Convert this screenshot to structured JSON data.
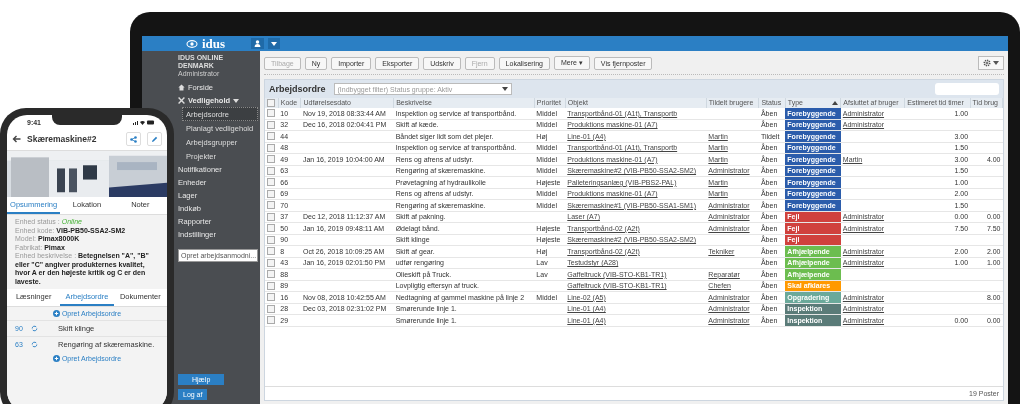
{
  "laptop": {
    "topbar": {
      "logo": "idus"
    },
    "sidebar": {
      "org": "IDUS ONLINE DENMARK",
      "user": "Administrator",
      "items": [
        {
          "label": "Forside",
          "selected": false
        },
        {
          "label": "Vedligehold",
          "selected": true,
          "expanded": true,
          "children": [
            {
              "label": "Arbejdsordre",
              "selected": true
            },
            {
              "label": "Planlagt vedligehold",
              "selected": false
            },
            {
              "label": "Arbejdsgrupper",
              "selected": false
            },
            {
              "label": "Projekter",
              "selected": false
            }
          ]
        },
        {
          "label": "Notifikationer",
          "selected": false
        },
        {
          "label": "Enheder",
          "selected": false
        },
        {
          "label": "Lager",
          "selected": false
        },
        {
          "label": "Indkøb",
          "selected": false
        },
        {
          "label": "Rapporter",
          "selected": false
        },
        {
          "label": "Indstillinger",
          "selected": false
        }
      ],
      "dropdown": "Opret arbejdsanmodni...",
      "help_button": "Hjælp",
      "logout_button": "Log af"
    },
    "toolbar": [
      {
        "label": "Tilbage",
        "disabled": true
      },
      {
        "label": "Ny",
        "disabled": false
      },
      {
        "label": "Importer",
        "disabled": false
      },
      {
        "label": "Eksporter",
        "disabled": false
      },
      {
        "label": "Udskriv",
        "disabled": false
      },
      {
        "label": "Fjern",
        "disabled": true
      },
      {
        "label": "Lokalisering",
        "disabled": false
      },
      {
        "label": "Mere ▾",
        "disabled": false
      },
      {
        "label": "Vis fjernposter",
        "disabled": false
      }
    ],
    "table": {
      "select_all_checked": false,
      "title": "Arbejdsordre",
      "filter": "(Indbygget filter) Status gruppe: Aktiv",
      "columns": [
        {
          "label": "Kode",
          "sorted": false
        },
        {
          "label": "Udførelsesdato",
          "sorted": false
        },
        {
          "label": "Beskrivelse",
          "sorted": false
        },
        {
          "label": "Prioritet",
          "sorted": false
        },
        {
          "label": "Objekt",
          "sorted": false
        },
        {
          "label": "Tildelt brugere",
          "sorted": false
        },
        {
          "label": "Status",
          "sorted": false
        },
        {
          "label": "Type",
          "sorted": true
        },
        {
          "label": "Afsluttet af bruger",
          "sorted": false
        },
        {
          "label": "Estimeret tid timer",
          "sorted": false
        },
        {
          "label": "Tid brug",
          "sorted": false
        }
      ],
      "rows": [
        {
          "checked": false,
          "code": "10",
          "date": "Nov 19, 2018 08:33:44 AM",
          "description": "Inspektion og service af transportbånd.",
          "priority": "Middel",
          "object": "Transportbånd-01 (A1t), Transportb",
          "status": "Åben",
          "type": {
            "label": "Forebyggende",
            "color": "#2b5cab"
          },
          "closed_by": "Administrator",
          "estimate": "1.00"
        },
        {
          "checked": false,
          "code": "32",
          "date": "Dec 16, 2018 02:04:41 PM",
          "description": "Skift af kæde.",
          "priority": "Middel",
          "object": "Produktions maskine-01 (A7)",
          "status": "Åben",
          "type": {
            "label": "Forebyggende",
            "color": "#2b5cab"
          },
          "closed_by": "Administrator"
        },
        {
          "checked": false,
          "code": "44",
          "description": "Båndet siger lidt som det plejer.",
          "priority": "Høj",
          "object": "Line-01 (A4)",
          "assigned": "Martin",
          "status": "Tildelt",
          "type": {
            "label": "Forebyggende",
            "color": "#2b5cab"
          },
          "estimate": "3.00"
        },
        {
          "checked": false,
          "code": "48",
          "description": "Inspektion og service af transportbånd.",
          "priority": "Middel",
          "object": "Transportbånd-01 (A1t), Transportb",
          "assigned": "Martin",
          "status": "Åben",
          "type": {
            "label": "Forebyggende",
            "color": "#2b5cab"
          },
          "estimate": "1.50"
        },
        {
          "checked": false,
          "code": "49",
          "date": "Jan 16, 2019 10:04:00 AM",
          "description": "Rens og afrens af udstyr.",
          "priority": "Middel",
          "object": "Produktions maskine-01 (A7)",
          "assigned": "Martin",
          "status": "Åben",
          "type": {
            "label": "Forebyggende",
            "color": "#2b5cab"
          },
          "closed_by": "Martin",
          "estimate": "3.00",
          "time_used": "4.00"
        },
        {
          "checked": false,
          "code": "63",
          "description": "Rengøring af skæremaskine.",
          "priority": "Middel",
          "object": "Skæremaskine#2 (VIB-PB50-SSA2-SM2)",
          "assigned": "Administrator",
          "status": "Åben",
          "type": {
            "label": "Forebyggende",
            "color": "#2b5cab"
          },
          "estimate": "1.50"
        },
        {
          "checked": false,
          "code": "66",
          "description": "Prøvetagning af hydraulikolie",
          "priority": "Højeste",
          "object": "Palleteringsanlæg (VIB-PBS2-PAL)",
          "assigned": "Martin",
          "status": "Åben",
          "type": {
            "label": "Forebyggende",
            "color": "#2b5cab"
          },
          "estimate": "1.00"
        },
        {
          "checked": false,
          "code": "69",
          "description": "Rens og afrens af udstyr.",
          "priority": "Middel",
          "object": "Produktions maskine-01 (A7)",
          "assigned": "Martin",
          "status": "Åben",
          "type": {
            "label": "Forebyggende",
            "color": "#2b5cab"
          },
          "estimate": "2.00"
        },
        {
          "checked": false,
          "code": "70",
          "description": "Rengøring af skæremaskine.",
          "priority": "Middel",
          "object": "Skæremaskine#1 (VIB-PB50-SSA1-SM1)",
          "assigned": "Administrator",
          "status": "Åben",
          "type": {
            "label": "Forebyggende",
            "color": "#2b5cab"
          },
          "estimate": "1.50"
        },
        {
          "checked": false,
          "code": "37",
          "date": "Dec 12, 2018 11:12:37 AM",
          "description": "Skift af pakning.",
          "object": "Laser (A7)",
          "assigned": "Administrator",
          "status": "Åben",
          "type": {
            "label": "Fejl",
            "color": "#d0413d"
          },
          "closed_by": "Administrator",
          "estimate": "0.00",
          "time_used": "0.00"
        },
        {
          "checked": false,
          "code": "50",
          "date": "Jan 16, 2019 09:48:11 AM",
          "description": "Ødelagt bånd.",
          "priority": "Højeste",
          "object": "Transportbånd-02 (A2t)",
          "assigned": "Administrator",
          "status": "Åben",
          "type": {
            "label": "Fejl",
            "color": "#d0413d"
          },
          "closed_by": "Administrator",
          "estimate": "7.50",
          "time_used": "7.50"
        },
        {
          "checked": false,
          "code": "90",
          "description": "Skift klinge",
          "priority": "Højeste",
          "object": "Skæremaskine#2 (VIB-PB50-SSA2-SM2)",
          "status": "Åben",
          "type": {
            "label": "Fejl",
            "color": "#d0413d"
          }
        },
        {
          "checked": false,
          "code": "8",
          "date": "Oct 26, 2018 10:09:25 AM",
          "description": "Skift af gear.",
          "priority": "Høj",
          "object": "Transportbånd-02 (A2t)",
          "assigned": "Tekniker",
          "status": "Åben",
          "type": {
            "label": "Afhjælpende",
            "color": "#6cbd4f"
          },
          "closed_by": "Administrator",
          "estimate": "2.00",
          "time_used": "2.00"
        },
        {
          "checked": false,
          "code": "43",
          "date": "Jan 16, 2019 02:01:50 PM",
          "description": "udfør rengøring",
          "priority": "Lav",
          "object": "Testudstyr (A28)",
          "status": "Åben",
          "type": {
            "label": "Afhjælpende",
            "color": "#6cbd4f"
          },
          "closed_by": "Administrator",
          "estimate": "1.00",
          "time_used": "1.00"
        },
        {
          "checked": false,
          "code": "88",
          "description": "Olieskift på Truck.",
          "priority": "Lav",
          "object": "Gaffeltruck (VIB-STO-KB1-TR1)",
          "assigned": "Reparatør",
          "status": "Åben",
          "type": {
            "label": "Afhjælpende",
            "color": "#6cbd4f"
          }
        },
        {
          "checked": false,
          "code": "89",
          "description": "Lovpligtig eftersyn af truck.",
          "object": "Gaffeltruck (VIB-STO-KB1-TR1)",
          "assigned": "Chefen",
          "status": "Åben",
          "type": {
            "label": "Skal afklares",
            "color": "#ff9900"
          }
        },
        {
          "checked": false,
          "code": "16",
          "date": "Nov 08, 2018 10:42:55 AM",
          "description": "Nedtagning af gammel maskine på linje 2",
          "priority": "Middel",
          "object": "Line-02 (A5)",
          "assigned": "Administrator",
          "status": "Åben",
          "type": {
            "label": "Opgradering",
            "color": "#6aa99a"
          },
          "closed_by": "Administrator",
          "time_used": "8.00"
        },
        {
          "checked": false,
          "code": "28",
          "date": "Dec 03, 2018 02:31:02 PM",
          "description": "Smørerunde linje 1.",
          "object": "Line-01 (A4)",
          "assigned": "Administrator",
          "status": "Åben",
          "type": {
            "label": "Inspektion",
            "color": "#5a7b78"
          },
          "closed_by": "Administrator"
        },
        {
          "checked": false,
          "code": "29",
          "description": "Smørerunde linje 1.",
          "object": "Line-01 (A4)",
          "assigned": "Administrator",
          "status": "Åben",
          "type": {
            "label": "Inspektion",
            "color": "#5a7b78"
          },
          "closed_by": "Administrator",
          "estimate": "0.00",
          "time_used": "0.00"
        }
      ],
      "footer": "19 Poster"
    }
  },
  "phone": {
    "time": "9:41",
    "title": "Skæremaskine#2",
    "tabs": [
      {
        "label": "Opsummering",
        "selected": true
      },
      {
        "label": "Lokation",
        "selected": false
      },
      {
        "label": "Noter",
        "selected": false
      }
    ],
    "details": [
      {
        "label": "Enhed status :",
        "value": "Online",
        "kind": "status"
      },
      {
        "label": "Enhed kode:",
        "value": "VIB-PB50-SSA2-SM2",
        "kind": "text"
      },
      {
        "label": "Model:",
        "value": "Pimax8000K",
        "kind": "text"
      },
      {
        "label": "Fabrikat:",
        "value": "Pimax",
        "kind": "text"
      },
      {
        "label": "Enhed beskrivelse :",
        "value": "Betegnelsen \"A\", \"B\" eller \"C\" angiver produkternes kvalitet, hvor A er den højeste kritik og C er den laveste.",
        "kind": "text"
      }
    ],
    "tabs2": [
      {
        "label": "Læsninger",
        "selected": false
      },
      {
        "label": "Arbejdsordre",
        "selected": true
      },
      {
        "label": "Dokumenter",
        "selected": false
      }
    ],
    "create_link": "Opret Arbejdsordre",
    "orders": [
      {
        "code": "90",
        "title": "Skift klinge"
      },
      {
        "code": "63",
        "title": "Rengøring af skæremaskine."
      }
    ],
    "create_link_bottom": "Opret Arbejdsordre"
  }
}
